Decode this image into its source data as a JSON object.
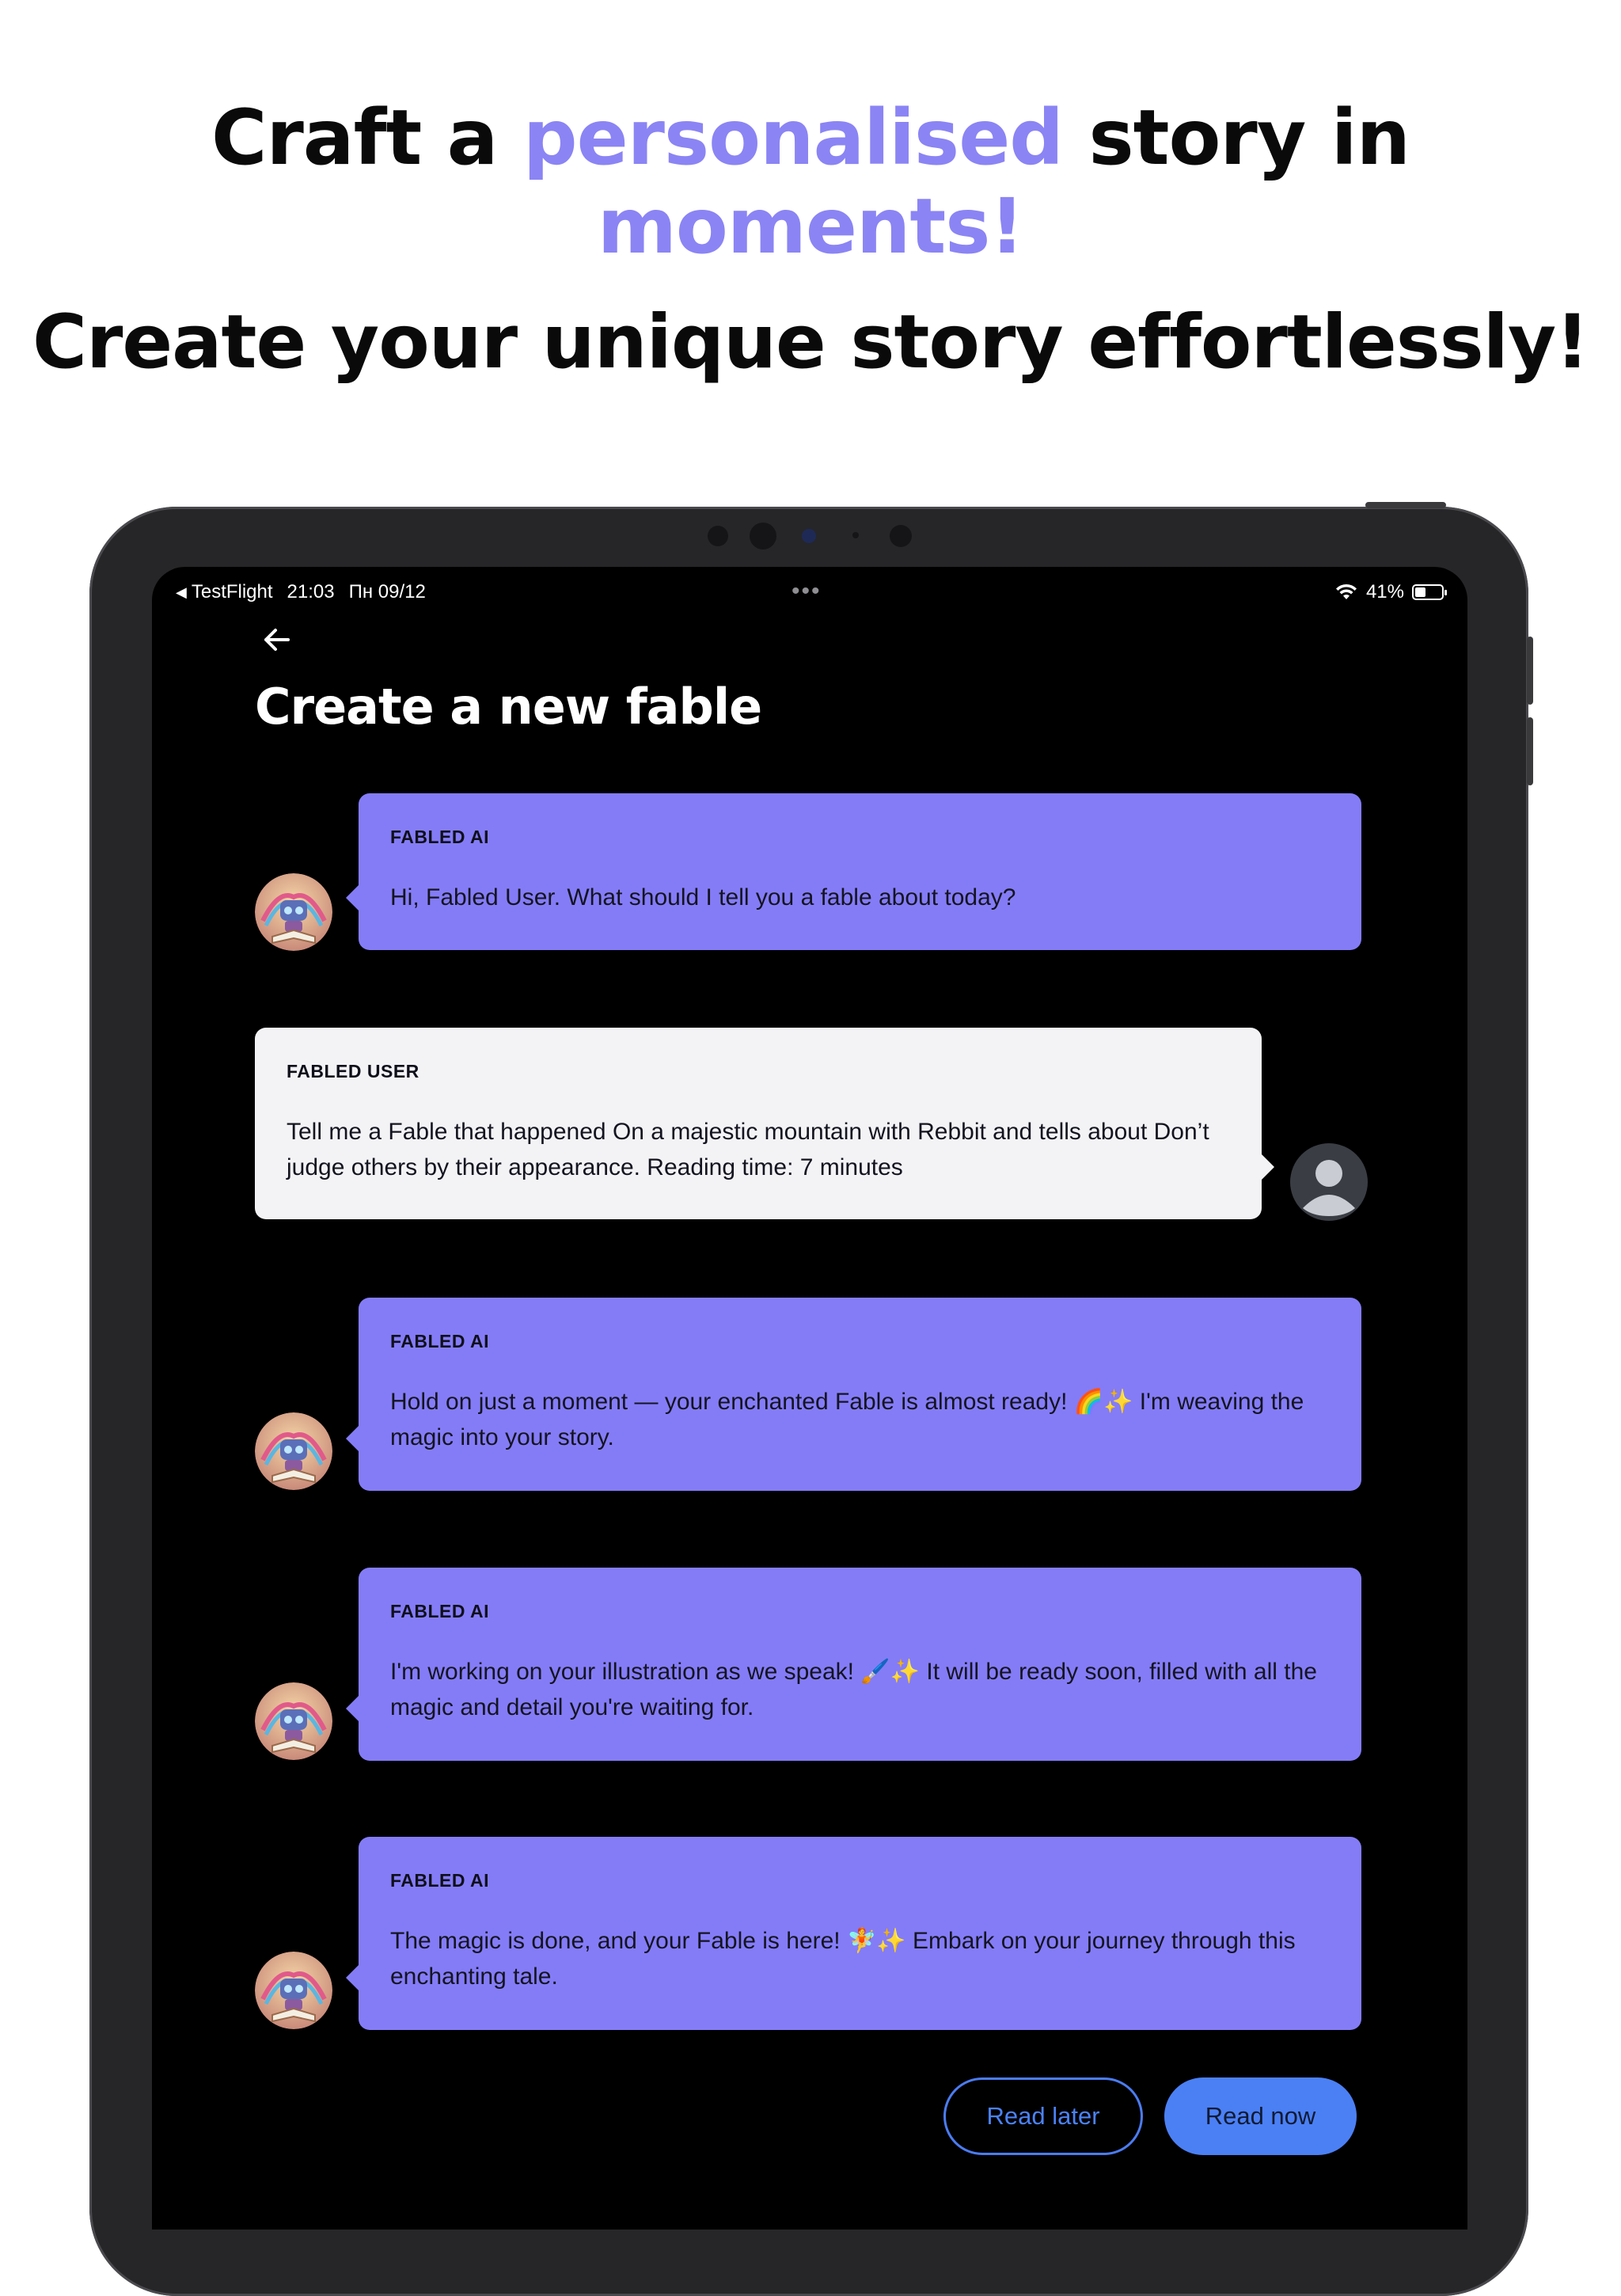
{
  "headline": {
    "line1_pre": "Craft a",
    "line1_accent": "personalised",
    "line1_post": "story in",
    "line2_accent": "moments!",
    "subheadline": "Create your unique story effortlessly!",
    "accent_color": "#8b84f4"
  },
  "statusbar": {
    "back_app": "TestFlight",
    "time": "21:03",
    "date": "Пн 09/12",
    "battery": "41%",
    "battery_level": 0.41
  },
  "screen": {
    "title": "Create a new fable",
    "back_icon": "arrow-left-icon"
  },
  "messages": [
    {
      "author": "FABLED AI",
      "text": "Hi, Fabled User. What should I tell you a fable about today?"
    },
    {
      "author": "FABLED USER",
      "text": "Tell me a Fable that happened On a majestic mountain with Rebbit and tells about Don’t judge others by their appearance. Reading time: 7 minutes"
    },
    {
      "author": "FABLED AI",
      "text": "Hold on just a moment — your enchanted Fable is almost ready! 🌈✨ I'm weaving the magic into your story."
    },
    {
      "author": "FABLED AI",
      "text": "I'm working on your illustration as we speak! 🖌️✨ It will be ready soon, filled with all the magic and detail you're waiting for."
    },
    {
      "author": "FABLED AI",
      "text": "The magic is done, and your Fable is here! 🧚✨ Embark on your journey through this enchanting tale."
    }
  ],
  "actions": {
    "read_later": "Read later",
    "read_now": "Read now"
  },
  "colors": {
    "ai_bubble": "#847cf7",
    "user_bubble": "#f3f3f6",
    "primary_button": "#4b80f5"
  }
}
